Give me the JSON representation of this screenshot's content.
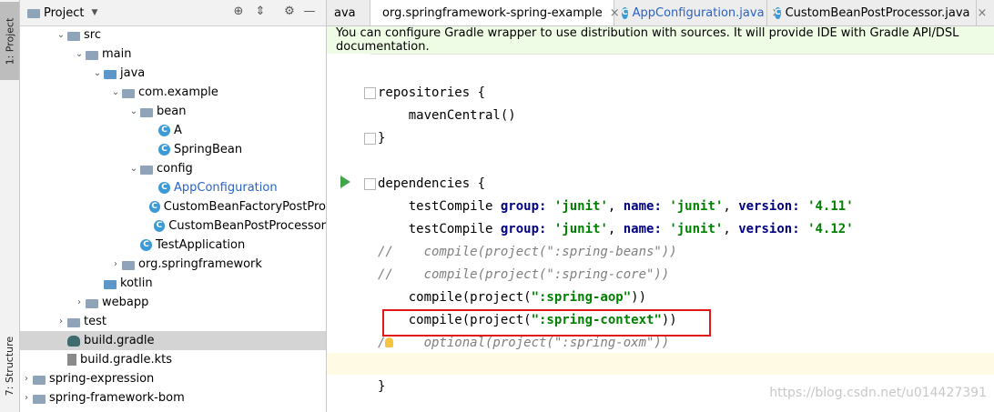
{
  "tool_strip": {
    "project_tab": "1: Project",
    "structure_tab": "7: Structure"
  },
  "project_panel": {
    "title": "Project",
    "header_icons": [
      "target-icon",
      "collapse-icon",
      "gear-icon",
      "minimize-icon"
    ],
    "tree": [
      {
        "label": "src",
        "expanded": true,
        "icon": "folder"
      },
      {
        "label": "main",
        "expanded": true,
        "icon": "folder"
      },
      {
        "label": "java",
        "expanded": true,
        "icon": "source-folder"
      },
      {
        "label": "com.example",
        "expanded": true,
        "icon": "package"
      },
      {
        "label": "bean",
        "expanded": true,
        "icon": "package"
      },
      {
        "label": "A",
        "icon": "class"
      },
      {
        "label": "SpringBean",
        "icon": "class"
      },
      {
        "label": "config",
        "expanded": true,
        "icon": "package"
      },
      {
        "label": "AppConfiguration",
        "icon": "class",
        "highlight": true
      },
      {
        "label": "CustomBeanFactoryPostPro",
        "icon": "class"
      },
      {
        "label": "CustomBeanPostProcessor",
        "icon": "class"
      },
      {
        "label": "TestApplication",
        "icon": "class"
      },
      {
        "label": "org.springframework",
        "expanded": false,
        "icon": "package"
      },
      {
        "label": "kotlin",
        "icon": "source-folder"
      },
      {
        "label": "webapp",
        "expanded": false,
        "icon": "folder"
      },
      {
        "label": "test",
        "expanded": false,
        "icon": "folder"
      },
      {
        "label": "build.gradle",
        "icon": "gradle",
        "selected": true
      },
      {
        "label": "build.gradle.kts",
        "icon": "kts"
      },
      {
        "label": "spring-expression",
        "expanded": false,
        "icon": "module"
      },
      {
        "label": "spring-framework-bom",
        "expanded": false,
        "icon": "module"
      }
    ]
  },
  "editor": {
    "tabs": [
      {
        "label": "ava",
        "icon": "none"
      },
      {
        "label": "org.springframework-spring-example",
        "icon": "gradle",
        "active": true
      },
      {
        "label": "AppConfiguration.java",
        "icon": "class"
      },
      {
        "label": "CustomBeanPostProcessor.java",
        "icon": "class"
      }
    ],
    "banner": "You can configure Gradle wrapper to use distribution with sources. It will provide IDE with Gradle API/DSL documentation.",
    "code": {
      "repositories": "repositories {",
      "maven_central": "    mavenCentral()",
      "close1": "}",
      "dependencies": "dependencies {",
      "tc1": {
        "fn": "    testCompile ",
        "k1": "group",
        "s1": "'junit'",
        "k2": "name",
        "s2": "'junit'",
        "k3": "version",
        "s3": "'4.11'"
      },
      "tc2": {
        "fn": "    testCompile ",
        "k1": "group",
        "s1": "'junit'",
        "k2": "name",
        "s2": "'junit'",
        "k3": "version",
        "s3": "'4.12'"
      },
      "c1": "//    compile(project(\":spring-beans\"))",
      "c2": "//    compile(project(\":spring-core\"))",
      "aop_pre": "    compile(project(",
      "aop_str": "\":spring-aop\"",
      "aop_post": "))",
      "ctx_pre": "    compile(project(",
      "ctx_str": "\":spring-context\"",
      "ctx_post": "))",
      "oxm": "/     optional(project(\":spring-oxm\"))",
      "close2": "}"
    },
    "watermark": "https://blog.csdn.net/u014427391"
  },
  "colors": {
    "highlight_box": "#e01818",
    "banner_bg": "#eefbe5",
    "run_icon": "#3fa54a"
  }
}
